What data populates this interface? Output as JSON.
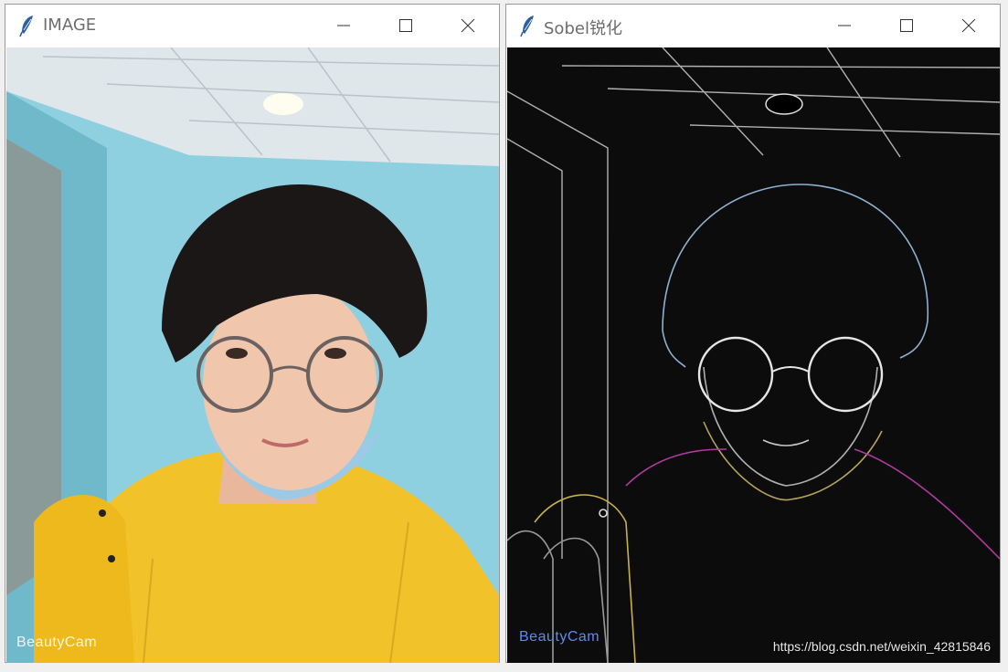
{
  "windows": [
    {
      "title": "IMAGE",
      "image_label": "BeautyCam"
    },
    {
      "title": "Sobel锐化",
      "image_label": "BeautyCam"
    }
  ],
  "url_watermark": "https://blog.csdn.net/weixin_42815846",
  "icons": {
    "app": "feather-icon",
    "minimize": "minimize-icon",
    "maximize": "maximize-icon",
    "close": "close-icon"
  },
  "colors": {
    "wall": "#8fd0e0",
    "sweater": "#f2c22a",
    "edge_bg": "#0c0c0c",
    "edge_line": "#d8d8d8",
    "feather": "#2a5fa0"
  }
}
